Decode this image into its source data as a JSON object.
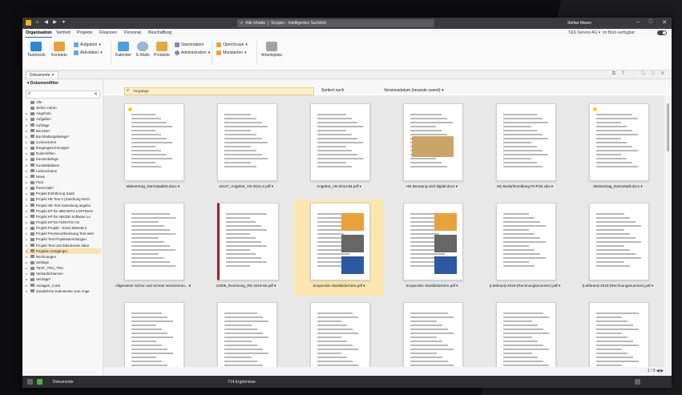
{
  "titlebar": {
    "search_scope": "Alle Inhalte",
    "search_placeholder": "Scopen - Intelligentes Suchfeld",
    "user": "Stefan Maren"
  },
  "menu": {
    "tabs": [
      "Organisation",
      "Vertrieb",
      "Projekte",
      "Finanzen",
      "Personal",
      "Beschaffung"
    ],
    "company": "T&S Service AG",
    "availability": "Im Büro verfügbar"
  },
  "ribbon": {
    "teamwork": "Teamwork",
    "kontakte": "Kontakte",
    "aufgaben": "Aufgaben",
    "aktivitaeten": "Aktivitäten",
    "kalender": "Kalender",
    "emails": "E-Mails",
    "produkte": "Produkte",
    "stammdaten": "Stammdaten",
    "administration": "Administration",
    "openscope": "OpenScope",
    "mandanten": "Mandanten",
    "arbeitsplatz": "Arbeitsplatz"
  },
  "doc_tab": "Dokumente",
  "left": {
    "title": "Dokumentfilter",
    "items": [
      "Alle",
      "stefan maren",
      "Angebote",
      "Aufgaben",
      "Aufträge",
      "Berichte*",
      "Buchhaltungsbelege*",
      "Connectoren",
      "Eingangsrechnungen",
      "Gutschriften",
      "Kassenbelege",
      "Kontaktdateien",
      "Lieferscheine",
      "News",
      "Post",
      "Potenziale*",
      "Projekt Einführung SaaS",
      "Projekt HE Test 3 (Sandrung NACI",
      "Projekt HE Test Sammlung angebo",
      "Projekt KP für JBKOEFS-LOFTMAN",
      "Projekt KP für ABCDE Software Lu",
      "Projekt KP für FORATIS AG",
      "Projekt Projekt - Event Münster2",
      "Projekt Pressevorbereitung Test anst",
      "Projekt Test Projektsammlungen",
      "Projekt Test und Dokumente dann",
      "Projekte (Vorgänge)",
      "Rechnungen",
      "Settings",
      "TEST_TRU_TRU",
      "Verkaufschancen",
      "Verträge*",
      "Vorlagen_Cobit",
      "Zusätzliche Dokumente zum Ange"
    ]
  },
  "main": {
    "search_value": "Vorgänge",
    "sort_label": "Sortiert nach",
    "sort_value": "Versionsdatum (neueste zuerst)",
    "files": [
      "Mietvertrag_Darmstadt03.docx ▾",
      "10127_Angebot_AN-2011-2.pdf ▾",
      "Angebot_AN-2014-84.pdf ▾",
      "HE Beratung wird digital.docx ▾",
      "HE Bedarfsmeldung PicPick.xlsx ▾",
      "Mietvertrag_Darmstadt.docx ▾",
      "Allgemeine Sicher und Schutz Versicherun... ▾",
      "10006_Rechnung_RE-2019-60.pdf ▾",
      "Scopevisio Startbildschirm.pdf ▾",
      "Scopevisio Startbildschirm.pdf ▾",
      "(Lieferant)-2019-(Rechnungsnummer).pdf ▾",
      "(Lieferant)-2019-(Rechnungsnummer).pdf ▾",
      "",
      "",
      "",
      "",
      "",
      ""
    ],
    "page": "1 / 9"
  },
  "status": {
    "section": "Dokumente",
    "results": "714 Ergebnisse"
  },
  "colors": {
    "accent": "#2c6bb5",
    "selection": "#fbe6b0",
    "titlebar": "#3a3a3c"
  }
}
